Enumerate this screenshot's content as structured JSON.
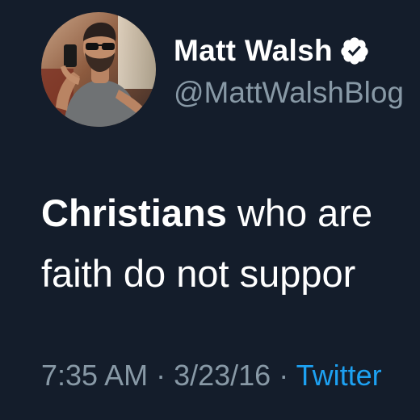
{
  "tweet": {
    "display_name": "Matt Walsh",
    "handle": "@MattWalshBlog",
    "text_bold": "Christians",
    "text_line1_rest": " who are",
    "text_line2": "faith do not suppor",
    "time": "7:35 AM",
    "separator": " · ",
    "date": "3/23/16",
    "source": "Twitter"
  },
  "icons": {
    "verified": "verified-badge-icon",
    "avatar": "profile-photo"
  },
  "colors": {
    "background": "#141d2b",
    "name": "#ffffff",
    "handle": "#8899a6",
    "link": "#1da1f2"
  }
}
